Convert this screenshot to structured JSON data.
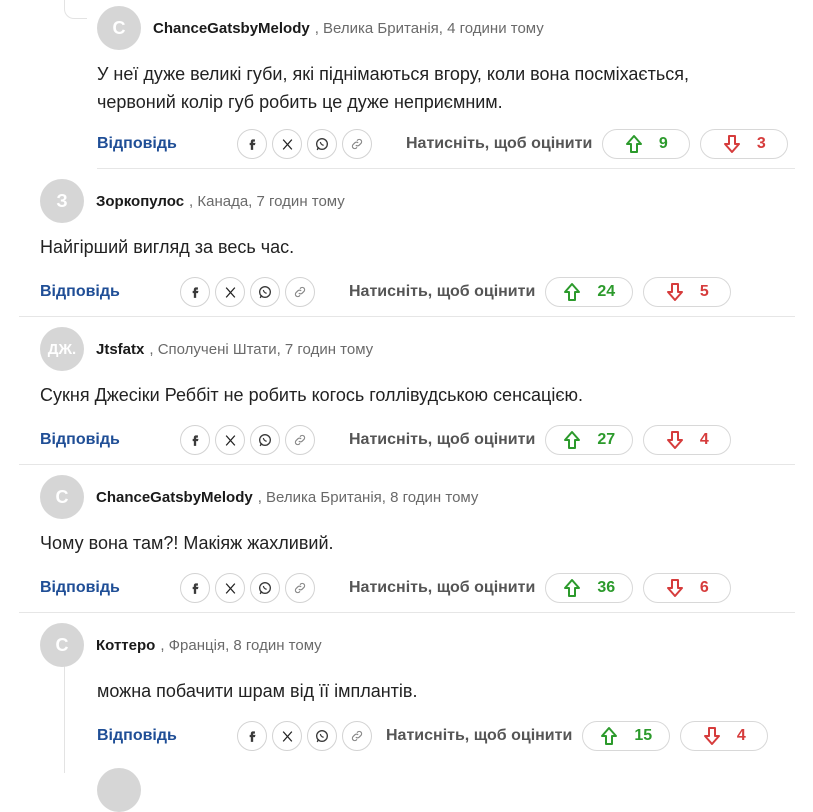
{
  "colors": {
    "accent_link": "#1f4e96",
    "upvote": "#2c9a2c",
    "downvote": "#d63c3c",
    "avatar_bg": "#d6d6d6"
  },
  "icons": [
    "facebook-icon",
    "x-icon",
    "whatsapp-icon",
    "link-icon",
    "arrow-up-icon",
    "arrow-down-icon"
  ],
  "comments": [
    {
      "avatar_letter": "С",
      "username": "ChanceGatsbyMelody",
      "meta": ", Велика Британія, 4 години тому",
      "text_lines": [
        "У неї дуже великі губи, які піднімаються вгору, коли вона посміхається,",
        "червоний колір губ робить це дуже неприємним."
      ],
      "reply_label": "Відповідь",
      "rate_label": "Натисніть, щоб оцінити",
      "upvotes": "9",
      "downvotes": "3"
    },
    {
      "avatar_letter": "З",
      "username": "Зоркопулос",
      "meta": ", Канада, 7 годин тому",
      "text_lines": [
        "Найгірший вигляд за весь час."
      ],
      "reply_label": "Відповідь",
      "rate_label": "Натисніть, щоб оцінити",
      "upvotes": "24",
      "downvotes": "5"
    },
    {
      "avatar_letter": "ДЖ.",
      "username": "Jtsfatx",
      "meta": ", Сполучені Штати, 7 годин тому",
      "text_lines": [
        "Сукня Джесіки Реббіт не робить когось голлівудською сенсацією."
      ],
      "reply_label": "Відповідь",
      "rate_label": "Натисніть, щоб оцінити",
      "upvotes": "27",
      "downvotes": "4"
    },
    {
      "avatar_letter": "С",
      "username": "ChanceGatsbyMelody",
      "meta": ", Велика Британія, 8 годин тому",
      "text_lines": [
        "Чому вона там?! Макіяж жахливий."
      ],
      "reply_label": "Відповідь",
      "rate_label": "Натисніть, щоб оцінити",
      "upvotes": "36",
      "downvotes": "6"
    },
    {
      "avatar_letter": "С",
      "username": "Коттеро",
      "meta": ", Франція, 8 годин тому",
      "text_lines": [
        "можна побачити шрам від її імплантів."
      ],
      "reply_label": "Відповідь",
      "rate_label": "Натисніть, щоб оцінити",
      "upvotes": "15",
      "downvotes": "4"
    }
  ]
}
